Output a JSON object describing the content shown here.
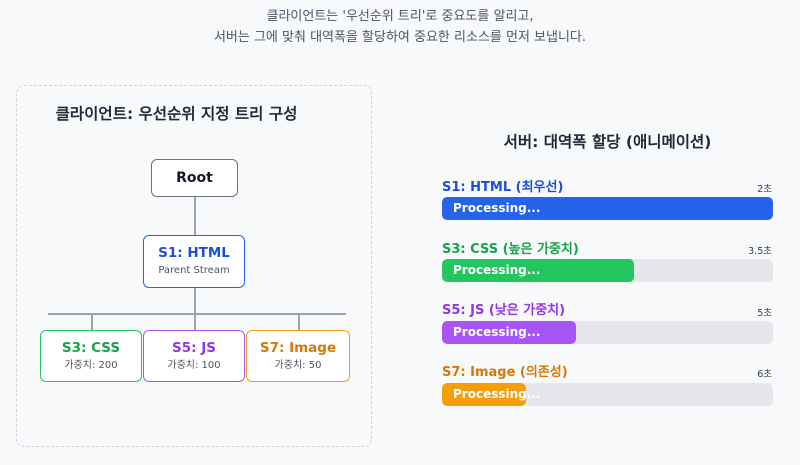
{
  "caption": {
    "line1": "클라이언트는 '우선순위 트리'로 중요도를 알리고,",
    "line2": "서버는 그에 맞춰 대역폭을 할당하여 중요한 리소스를 먼저 보냅니다."
  },
  "client": {
    "title": "클라이언트: 우선순위 지정 트리 구성",
    "root": {
      "label": "Root"
    },
    "html": {
      "label": "S1: HTML",
      "sub": "Parent Stream"
    },
    "children": [
      {
        "label": "S3: CSS",
        "sub": "가중치: 200",
        "color": "#16a34a"
      },
      {
        "label": "S5: JS",
        "sub": "가중치: 100",
        "color": "#9333ea"
      },
      {
        "label": "S7: Image",
        "sub": "가중치: 50",
        "color": "#d97706"
      }
    ]
  },
  "server": {
    "title": "서버: 대역폭 할당 (애니메이션)",
    "bars": [
      {
        "label": "S1: HTML (최우선)",
        "time": "2초",
        "status": "Processing...",
        "progress": 1.0,
        "color": "#2563eb",
        "label_color": "#1d4ed8"
      },
      {
        "label": "S3: CSS (높은 가중치)",
        "time": "3.5초",
        "status": "Processing...",
        "progress": 0.58,
        "color": "#22c55e",
        "label_color": "#16a34a"
      },
      {
        "label": "S5: JS (낮은 가중치)",
        "time": "5초",
        "status": "Processing...",
        "progress": 0.405,
        "color": "#a855f7",
        "label_color": "#9333ea"
      },
      {
        "label": "S7: Image (의존성)",
        "time": "6초",
        "status": "Processing...",
        "progress": 0.255,
        "color": "#f59e0b",
        "label_color": "#d97706"
      }
    ]
  }
}
